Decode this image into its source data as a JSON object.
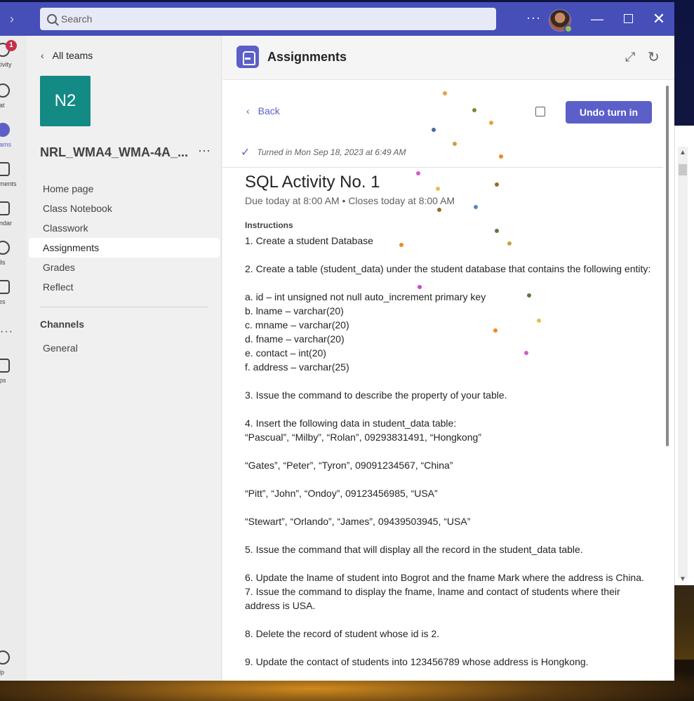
{
  "titlebar": {
    "search_placeholder": "Search"
  },
  "rail": {
    "activity_label": "ctivity",
    "activity_badge": "1",
    "chat_label": "hat",
    "teams_label": "eams",
    "assignments_label": "nments",
    "calendar_label": "endar",
    "calls_label": "alls",
    "files_label": "iles",
    "apps_label": "pps",
    "help_label": "elp"
  },
  "teampanel": {
    "all_teams": "All teams",
    "tile_initials": "N2",
    "team_name": "NRL_WMA4_WMA-4A_...",
    "nav": [
      "Home page",
      "Class Notebook",
      "Classwork",
      "Assignments",
      "Grades",
      "Reflect"
    ],
    "channels_title": "Channels",
    "channels": [
      "General"
    ]
  },
  "main": {
    "app_title": "Assignments",
    "back_label": "Back",
    "undo_button": "Undo turn in",
    "turned_in": "Turned in Mon Sep 18, 2023 at 6:49 AM",
    "assignment_title": "SQL Activity No. 1",
    "due": "Due today at 8:00 AM • Closes today at 8:00 AM",
    "instructions_label": "Instructions",
    "instructions": [
      "1. Create a student Database",
      "",
      "2. Create a table (student_data) under the student database that contains the following entity:",
      "",
      "a. id – int unsigned not null auto_increment primary key",
      "b. lname – varchar(20)",
      "c. mname – varchar(20)",
      "d. fname – varchar(20)",
      "e. contact – int(20)",
      "f. address – varchar(25)",
      "",
      "3. Issue the command to describe the property of your table.",
      "",
      "4. Insert the following data in student_data table:",
      "“Pascual”, “Milby”, “Rolan”, 09293831491, “Hongkong”",
      "",
      "“Gates”, “Peter”, “Tyron”, 09091234567, “China”",
      "",
      "“Pitt”, “John”, “Ondoy”, 09123456985, “USA”",
      "",
      "“Stewart”, “Orlando”, “James”, 09439503945, “USA”",
      "",
      "5. Issue the command that will display all the record in the student_data table.",
      "",
      "6. Update the lname of student into Bogrot and the fname Mark where the address is China.",
      "7. Issue the command to display the fname, lname and contact of students where their",
      "address is USA.",
      "",
      "8. Delete the record of student whose id is 2.",
      "",
      "9. Update the contact of students into 123456789 whose address is Hongkong."
    ]
  },
  "colors": {
    "brand": "#5b5fc7",
    "titlebar": "#464eb8",
    "team_tile": "#138a84",
    "badge": "#c4314b"
  }
}
